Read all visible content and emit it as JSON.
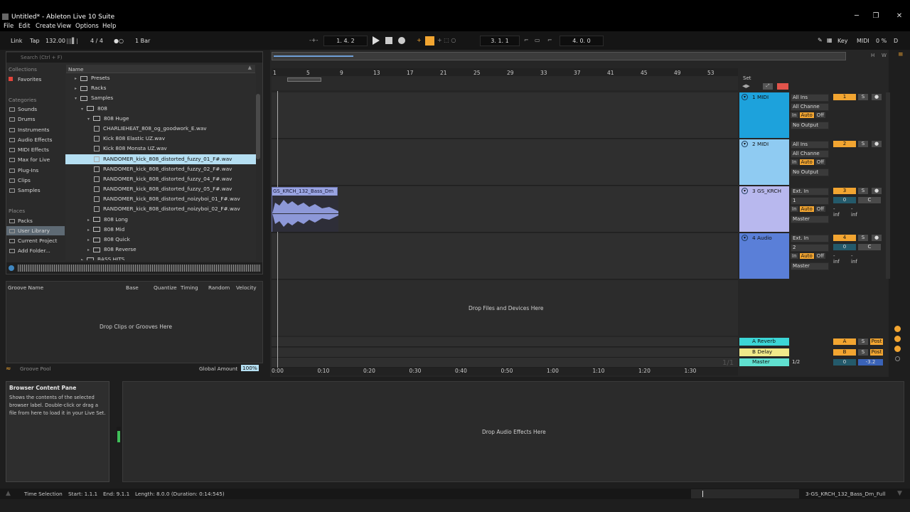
{
  "window": {
    "title": "Untitled* - Ableton Live 10 Suite",
    "min": "─",
    "max": "❐",
    "close": "✕"
  },
  "menu": [
    "File",
    "Edit",
    "Create",
    "View",
    "Options",
    "Help"
  ],
  "control_bar": {
    "link": "Link",
    "tap": "Tap",
    "tempo": "132.00",
    "signature": "4 / 4",
    "metro_dots": "●○",
    "quantize": "1 Bar",
    "arrangement_pos": "1.   4.   2",
    "loop_start": "3.   1.   1",
    "loop_length": "4.   0.   0",
    "key": "Key",
    "midi": "MIDI",
    "cpu": "0 %",
    "disk": "D"
  },
  "browser": {
    "search_placeholder": "Search (Ctrl + F)",
    "collections_header": "Collections",
    "favorites": "Favorites",
    "categories_header": "Categories",
    "categories": [
      "Sounds",
      "Drums",
      "Instruments",
      "Audio Effects",
      "MIDI Effects",
      "Max for Live",
      "Plug-Ins",
      "Clips",
      "Samples"
    ],
    "places_header": "Places",
    "places": [
      "Packs",
      "User Library",
      "Current Project",
      "Add Folder..."
    ],
    "name_col": "Name",
    "tree": [
      {
        "label": "Presets",
        "depth": 1,
        "type": "folder",
        "arrow": "▸"
      },
      {
        "label": "Racks",
        "depth": 1,
        "type": "folder",
        "arrow": "▸"
      },
      {
        "label": "Samples",
        "depth": 1,
        "type": "folder",
        "arrow": "▾"
      },
      {
        "label": "808",
        "depth": 2,
        "type": "folder",
        "arrow": "▾"
      },
      {
        "label": "808 Huge",
        "depth": 3,
        "type": "folder",
        "arrow": "▾"
      },
      {
        "label": "CHARLIEHEAT_808_og_goodwork_E.wav",
        "depth": 4,
        "type": "file"
      },
      {
        "label": "Kick 808 Elastic UZ.wav",
        "depth": 4,
        "type": "file"
      },
      {
        "label": "Kick 808 Monsta UZ.wav",
        "depth": 4,
        "type": "file"
      },
      {
        "label": "RANDOMER_kick_808_distorted_fuzzy_01_F#.wav",
        "depth": 4,
        "type": "file",
        "selected": true
      },
      {
        "label": "RANDOMER_kick_808_distorted_fuzzy_02_F#.wav",
        "depth": 4,
        "type": "file"
      },
      {
        "label": "RANDOMER_kick_808_distorted_fuzzy_04_F#.wav",
        "depth": 4,
        "type": "file"
      },
      {
        "label": "RANDOMER_kick_808_distorted_fuzzy_05_F#.wav",
        "depth": 4,
        "type": "file"
      },
      {
        "label": "RANDOMER_kick_808_distorted_noizyboi_01_F#.wav",
        "depth": 4,
        "type": "file"
      },
      {
        "label": "RANDOMER_kick_808_distorted_noizyboi_02_F#.wav",
        "depth": 4,
        "type": "file"
      },
      {
        "label": "808 Long",
        "depth": 3,
        "type": "folder",
        "arrow": "▸"
      },
      {
        "label": "808 Mid",
        "depth": 3,
        "type": "folder",
        "arrow": "▸"
      },
      {
        "label": "808 Quick",
        "depth": 3,
        "type": "folder",
        "arrow": "▸"
      },
      {
        "label": "808 Reverse",
        "depth": 3,
        "type": "folder",
        "arrow": "▸"
      },
      {
        "label": "BASS HITS",
        "depth": 2,
        "type": "folder",
        "arrow": "▸"
      }
    ]
  },
  "groove": {
    "cols": [
      "Groove Name",
      "Base",
      "Quantize",
      "Timing",
      "Random",
      "Velocity"
    ],
    "drop": "Drop Clips or Grooves Here",
    "pool": "Groove Pool",
    "global_label": "Global Amount",
    "global_value": "100%"
  },
  "info": {
    "title": "Browser Content Pane",
    "text": "Shows the contents of the selected browser label. Double-click or drag a file from here to load it in your Live Set."
  },
  "device_drop": "Drop Audio Effects Here",
  "status": {
    "sel": "Time Selection",
    "start": "Start: 1.1.1",
    "end": "End: 9.1.1",
    "length": "Length: 8.0.0 (Duration: 0:14:545)",
    "clip": "3-GS_KRCH_132_Bass_Dm_Full"
  },
  "arrangement": {
    "bars": [
      "1",
      "5",
      "9",
      "13",
      "17",
      "21",
      "25",
      "29",
      "33",
      "37",
      "41",
      "45",
      "49",
      "53"
    ],
    "times": [
      "0:00",
      "0:10",
      "0:20",
      "0:30",
      "0:40",
      "0:50",
      "1:00",
      "1:10",
      "1:20",
      "1:30"
    ],
    "set_label": "Set",
    "drop_label": "Drop Files and Devices Here",
    "clip_name": "GS_KRCH_132_Bass_Dm",
    "page": "1/1",
    "tracks": [
      {
        "name": "1 MIDI",
        "color": "#1da2dc",
        "in": "All Ins",
        "ch": "All Channe",
        "auto": "Auto",
        "off": "Off",
        "out": "No Output",
        "num": "1"
      },
      {
        "name": "2 MIDI",
        "color": "#8fcbf2",
        "in": "All Ins",
        "ch": "All Channe",
        "auto": "Auto",
        "off": "Off",
        "out": "No Output",
        "num": "2"
      },
      {
        "name": "3 GS_KRCH",
        "color": "#b8b8ee",
        "in": "Ext. In",
        "ch": "1",
        "auto": "Auto",
        "off": "Off",
        "out": "Master",
        "num": "3",
        "vol": "0",
        "pan": "C",
        "inf1": "-inf",
        "inf2": "-inf"
      },
      {
        "name": "4 Audio",
        "color": "#5a7fd8",
        "in": "Ext. In",
        "ch": "2",
        "auto": "Auto",
        "off": "Off",
        "out": "Master",
        "num": "4",
        "vol": "0",
        "pan": "C",
        "inf1": "-inf",
        "inf2": "-inf"
      }
    ],
    "returns": [
      {
        "name": "A Reverb",
        "color": "#3cd6d6",
        "letter": "A",
        "post": "Post"
      },
      {
        "name": "B Delay",
        "color": "#f0e98a",
        "letter": "B",
        "post": "Post"
      }
    ],
    "master": {
      "name": "Master",
      "color": "#60e0d0",
      "ch": "1/2",
      "vol": "0",
      "db": "-3.2"
    }
  }
}
